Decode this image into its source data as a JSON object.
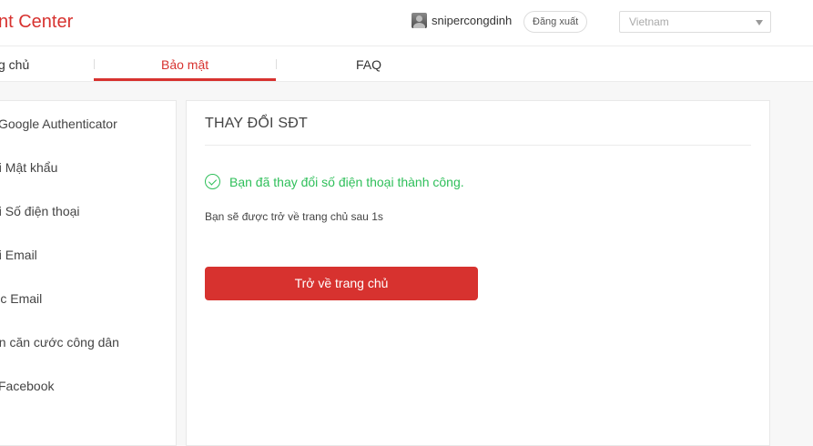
{
  "header": {
    "brand": "nt Center",
    "username": "snipercongdinh",
    "logout_label": "Đăng xuất",
    "language": "Vietnam"
  },
  "tabs": [
    {
      "label": "g chủ"
    },
    {
      "label": "Bảo mật"
    },
    {
      "label": "FAQ"
    }
  ],
  "sidebar": {
    "items": [
      {
        "label": "i Google Authenticator"
      },
      {
        "label": "ổi Mật khẩu"
      },
      {
        "label": "ổi Số điện thoại"
      },
      {
        "label": "ổi Email"
      },
      {
        "label": "ực Email"
      },
      {
        "label": "ận căn cước công dân"
      },
      {
        "label": "i Facebook"
      }
    ]
  },
  "main": {
    "title": "THAY ĐỔI SĐT",
    "success_message": "Bạn đã thay đổi số điện thoại thành công.",
    "redirect_message": "Bạn sẽ được trở về trang chủ sau 1s",
    "home_button": "Trở về trang chủ"
  },
  "colors": {
    "accent": "#d7322f",
    "success": "#2fbf5a"
  }
}
